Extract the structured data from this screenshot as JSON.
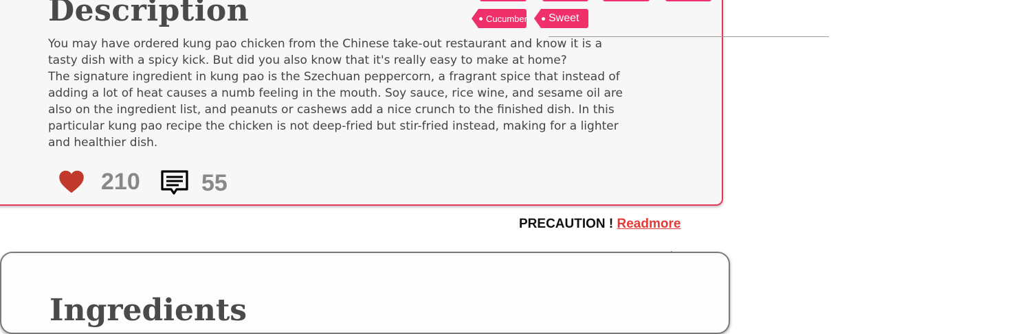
{
  "description": {
    "title": "Description",
    "paragraph1": "You may have ordered kung pao chicken from the Chinese take-out restaurant and know it is a tasty dish with a spicy kick. But did you also know that it's really easy to make at home?",
    "paragraph2": "The signature ingredient in kung pao is the Szechuan peppercorn, a fragrant spice that instead of adding a lot of heat causes a numb feeling in the mouth. Soy sauce, rice wine, and sesame oil are also on the ingredient list, and peanuts or cashews add a nice crunch to the finished dish. In this particular kung pao recipe the chicken is not deep-fried but stir-fried instead, making for a lighter and healthier dish."
  },
  "tags": [
    {
      "label": "Cucumber"
    },
    {
      "label": "Sweet"
    }
  ],
  "stats": {
    "likes": "210",
    "comments": "55"
  },
  "precaution": {
    "label": "PRECAUTION !",
    "link": "Readmore"
  },
  "ingredients": {
    "title": "Ingredients"
  },
  "colors": {
    "accent": "#e8365d",
    "tag": "#f0306a",
    "heart": "#c0392b",
    "link": "#e53935"
  },
  "icons": {
    "like": "heart-icon",
    "comment": "comment-icon",
    "pointer": "cursor-icon"
  }
}
